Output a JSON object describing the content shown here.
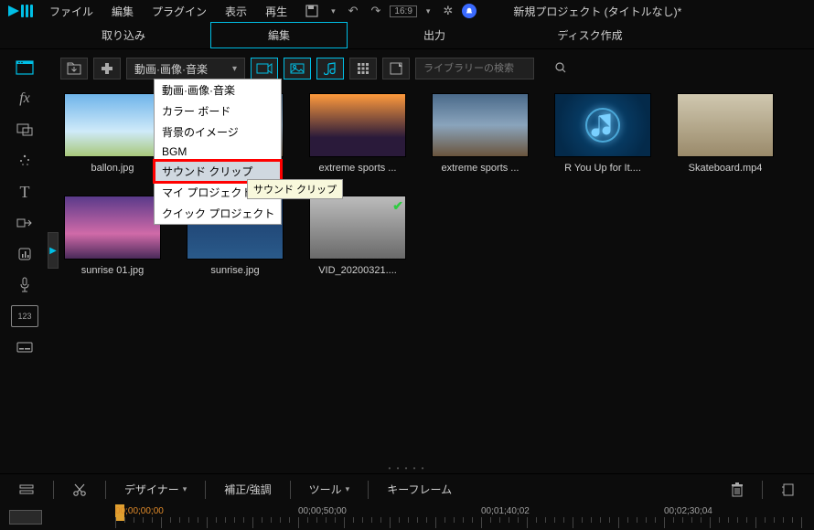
{
  "menubar": {
    "items": [
      "ファイル",
      "編集",
      "プラグイン",
      "表示",
      "再生"
    ],
    "project_title": "新規プロジェクト (タイトルなし)*",
    "aspect_label": "16:9"
  },
  "modetabs": {
    "items": [
      "取り込み",
      "編集",
      "出力",
      "ディスク作成"
    ],
    "active_index": 1
  },
  "lib_toolbar": {
    "dropdown_label": "動画·画像·音楽",
    "search_placeholder": "ライブラリーの検索"
  },
  "dropdown": {
    "items": [
      {
        "label": "動画·画像·音楽"
      },
      {
        "label": "カラー ボード"
      },
      {
        "label": "背景のイメージ"
      },
      {
        "label": "BGM"
      },
      {
        "label": "サウンド クリップ",
        "highlight": true
      },
      {
        "label": "マイ プロジェクト"
      },
      {
        "label": "クイック プロジェクト"
      }
    ],
    "tooltip": "サウンド クリップ"
  },
  "thumbs": [
    {
      "label": "ballon.jpg",
      "cls": "sky"
    },
    {
      "label": "extreme sports ...",
      "cls": "action"
    },
    {
      "label": "extreme sports ...",
      "cls": "sunset"
    },
    {
      "label": "extreme sports ...",
      "cls": "action"
    },
    {
      "label": "R You Up for It....",
      "cls": "music",
      "music": true
    },
    {
      "label": "Skateboard.mp4",
      "cls": "board"
    },
    {
      "label": "sunrise 01.jpg",
      "cls": "purple"
    },
    {
      "label": "sunrise.jpg",
      "cls": "sea"
    },
    {
      "label": "VID_20200321....",
      "cls": "city",
      "check": true
    }
  ],
  "editbar": {
    "designer": "デザイナー",
    "correction": "補正/強調",
    "tool": "ツール",
    "keyframe": "キーフレーム"
  },
  "timeline": {
    "labels": [
      {
        "text": "00;00;00;00",
        "pos": 0,
        "orange": true
      },
      {
        "text": "00;00;50;00",
        "pos": 200
      },
      {
        "text": "00;01;40;02",
        "pos": 400
      },
      {
        "text": "00;02;30;04",
        "pos": 600
      }
    ]
  }
}
